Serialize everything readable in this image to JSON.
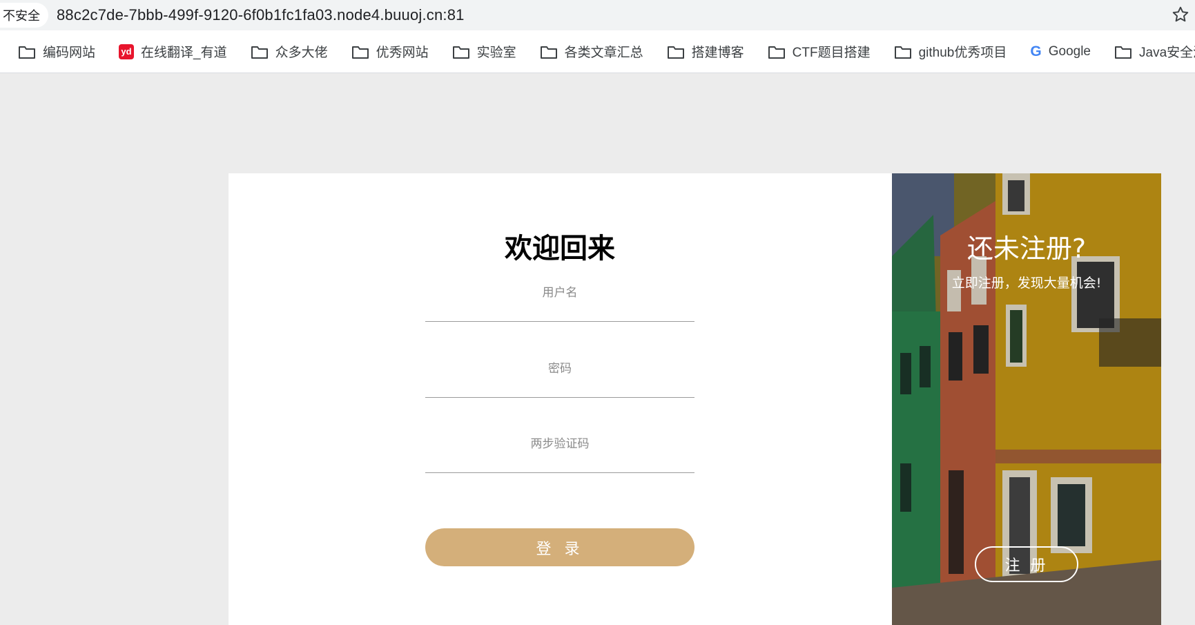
{
  "browser": {
    "security_label": "不安全",
    "url": "88c2c7de-7bbb-499f-9120-6f0b1fc1fa03.node4.buuoj.cn:81",
    "star_icon": "bookmark-star-icon"
  },
  "bookmarks": [
    {
      "label": "编码网站",
      "icon": "folder-icon"
    },
    {
      "label": "在线翻译_有道",
      "icon": "youdao-icon"
    },
    {
      "label": "众多大佬",
      "icon": "folder-icon"
    },
    {
      "label": "优秀网站",
      "icon": "folder-icon"
    },
    {
      "label": "实验室",
      "icon": "folder-icon"
    },
    {
      "label": "各类文章汇总",
      "icon": "folder-icon"
    },
    {
      "label": "搭建博客",
      "icon": "folder-icon"
    },
    {
      "label": "CTF题目搭建",
      "icon": "folder-icon"
    },
    {
      "label": "github优秀项目",
      "icon": "folder-icon"
    },
    {
      "label": "Google",
      "icon": "google-icon"
    },
    {
      "label": "Java安全漫谈",
      "icon": "folder-icon"
    }
  ],
  "login": {
    "title": "欢迎回来",
    "username_placeholder": "用户名",
    "password_placeholder": "密码",
    "otp_placeholder": "两步验证码",
    "submit_label": "登 录"
  },
  "promo": {
    "title": "还未注册?",
    "subtitle": "立即注册，发现大量机会!",
    "register_label": "注 册"
  },
  "colors": {
    "accent": "#d4af7a",
    "page_bg": "#ececec"
  }
}
